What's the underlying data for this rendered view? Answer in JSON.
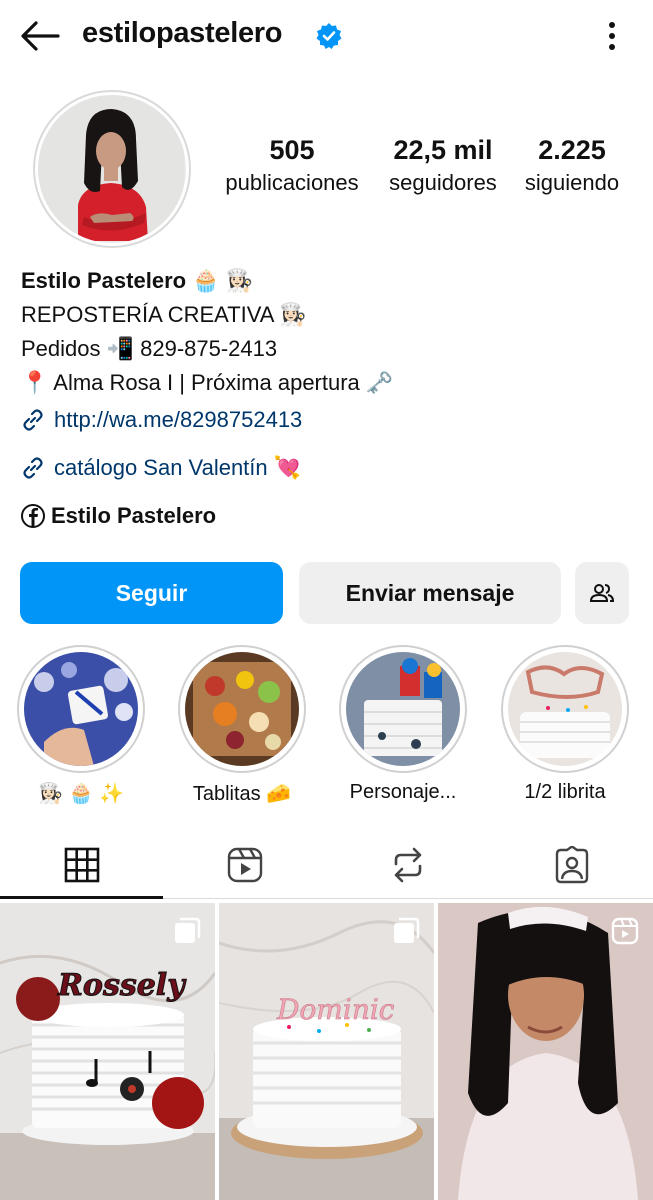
{
  "header": {
    "username": "estilopastelero",
    "back_icon": "arrow-left-icon",
    "verified_icon": "verified-badge-icon",
    "menu_icon": "kebab-menu-icon"
  },
  "stats": [
    {
      "value": "505",
      "label": "publicaciones"
    },
    {
      "value": "22,5 mil",
      "label": "seguidores"
    },
    {
      "value": "2.225",
      "label": "siguiendo"
    }
  ],
  "bio": {
    "name": "Estilo Pastelero 🧁 👩🏻‍🍳",
    "line1": "REPOSTERÍA CREATIVA 👩🏻‍🍳",
    "line2": "Pedidos 📲 829-875-2413",
    "line3": "📍 Alma Rosa I | Próxima apertura 🗝️",
    "link1": "http://wa.me/8298752413",
    "link2": "catálogo San Valentín 💘",
    "facebook": "Estilo Pastelero"
  },
  "actions": {
    "follow": "Seguir",
    "message": "Enviar mensaje",
    "suggest_icon": "add-people-icon"
  },
  "highlights": [
    {
      "caption": "👩🏻‍🍳 🧁 ✨"
    },
    {
      "caption": "Tablitas 🧀"
    },
    {
      "caption": "Personaje..."
    },
    {
      "caption": "1/2 librita"
    }
  ],
  "tabs": [
    {
      "icon": "grid-icon",
      "active": true
    },
    {
      "icon": "reels-icon",
      "active": false
    },
    {
      "icon": "reposts-icon",
      "active": false
    },
    {
      "icon": "tagged-icon",
      "active": false
    }
  ],
  "posts": [
    {
      "type": "carousel",
      "text": "Rossely"
    },
    {
      "type": "carousel",
      "text": "Dominic"
    },
    {
      "type": "reel",
      "text": ""
    }
  ],
  "colors": {
    "accent": "#0095f6",
    "link": "#00376b",
    "verified": "#0095f6"
  }
}
